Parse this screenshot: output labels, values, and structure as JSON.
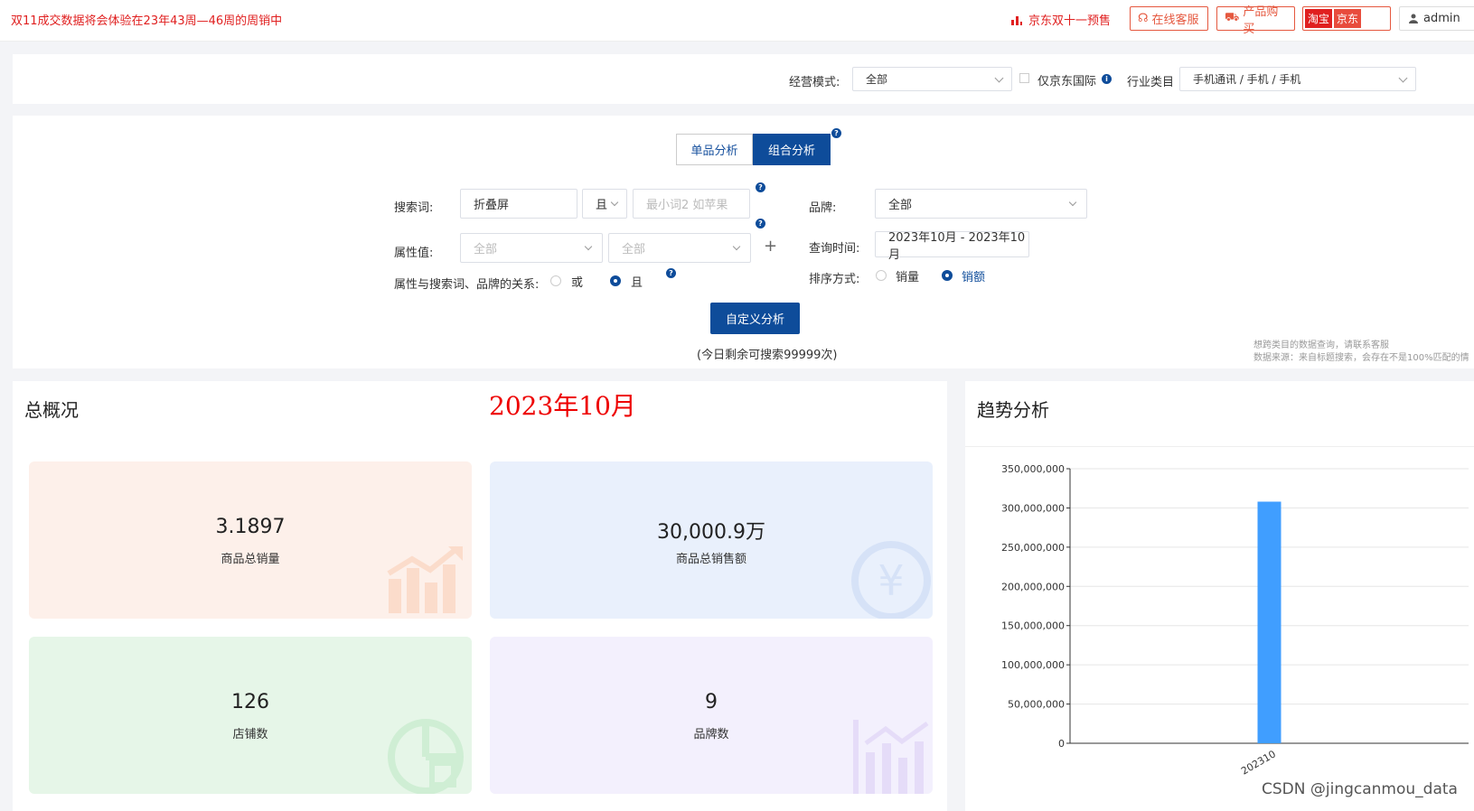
{
  "topbar": {
    "notice": "双11成交数据将会体验在23年43周—46周的周销中",
    "promo": "京东双十一预售",
    "service_btn": "在线客服",
    "buy_btn": "产品购买",
    "shop_taobao": "淘宝",
    "shop_jd": "京东",
    "user": "admin"
  },
  "filters": {
    "mode_label": "经营模式:",
    "mode_value": "全部",
    "intl_label": "仅京东国际",
    "category_label": "行业类目",
    "category_value": "手机通讯 / 手机 / 手机"
  },
  "search": {
    "tab_single": "单品分析",
    "tab_combo": "组合分析",
    "keyword_label": "搜索词:",
    "keyword_value": "折叠屏",
    "logic_value": "且",
    "keyword2_placeholder": "最小词2 如苹果",
    "brand_label": "品牌:",
    "brand_value": "全部",
    "attr_label": "属性值:",
    "attr1_placeholder": "全部",
    "attr2_placeholder": "全部",
    "time_label": "查询时间:",
    "time_value": "2023年10月 - 2023年10月",
    "relation_label": "属性与搜索词、品牌的关系:",
    "relation_or": "或",
    "relation_and": "且",
    "sort_label": "排序方式:",
    "sort_qty": "销量",
    "sort_amount": "销额",
    "analyze_btn": "自定义分析",
    "remain": "(今日剩余可搜索99999次)",
    "note1": "想跨类目的数据查询，请联系客服",
    "note2": "数据来源：来自标题搜索，会存在不是100%匹配的情"
  },
  "overview": {
    "title": "总概况",
    "date": "2023年10月",
    "cards": [
      {
        "value": "3.1897",
        "label": "商品总销量",
        "color": "#fdf0ea"
      },
      {
        "value": "30,000.9万",
        "label": "商品总销售额",
        "color": "#e9f0fc"
      },
      {
        "value": "126",
        "label": "店铺数",
        "color": "#e6f6e8"
      },
      {
        "value": "9",
        "label": "品牌数",
        "color": "#f3f0fd"
      }
    ]
  },
  "trend": {
    "title": "趋势分析"
  },
  "chart_data": {
    "type": "bar",
    "categories": [
      "202310"
    ],
    "values": [
      308000000
    ],
    "ylim": [
      0,
      350000000
    ],
    "yticks": [
      "0",
      "50,000,000",
      "100,000,000",
      "150,000,000",
      "200,000,000",
      "250,000,000",
      "300,000,000",
      "350,000,000"
    ],
    "bar_color": "#409eff",
    "grid": true
  },
  "watermark": "CSDN @jingcanmou_data"
}
